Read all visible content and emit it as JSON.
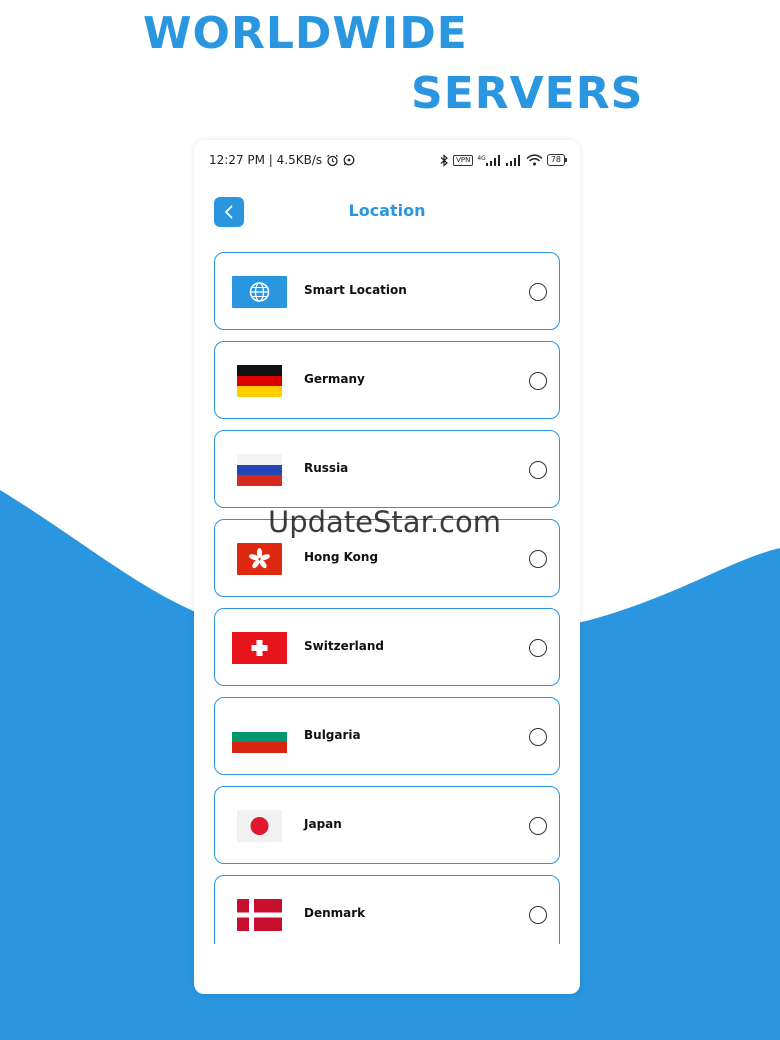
{
  "promo": {
    "headline_line1": "WORLDWIDE",
    "headline_line2": "SERVERS"
  },
  "status_bar": {
    "time_speed": "12:27 PM | 4.5KB/s",
    "vpn": "VPN",
    "network": "4G",
    "battery": "78"
  },
  "header": {
    "title": "Location",
    "back_icon": "chevron-left-icon"
  },
  "servers": [
    {
      "name": "Smart Location",
      "flag": "globe-icon",
      "selected": false
    },
    {
      "name": "Germany",
      "flag": "germany-flag",
      "selected": false
    },
    {
      "name": "Russia",
      "flag": "russia-flag",
      "selected": false
    },
    {
      "name": "Hong Kong",
      "flag": "hong-kong-flag",
      "selected": false
    },
    {
      "name": "Switzerland",
      "flag": "switzerland-flag",
      "selected": false
    },
    {
      "name": "Bulgaria",
      "flag": "bulgaria-flag",
      "selected": false
    },
    {
      "name": "Japan",
      "flag": "japan-flag",
      "selected": false
    },
    {
      "name": "Denmark",
      "flag": "denmark-flag",
      "selected": false
    }
  ],
  "watermark": "UpdateStar.com",
  "colors": {
    "accent": "#2a96e0",
    "background_wave": "#2a96e0"
  }
}
